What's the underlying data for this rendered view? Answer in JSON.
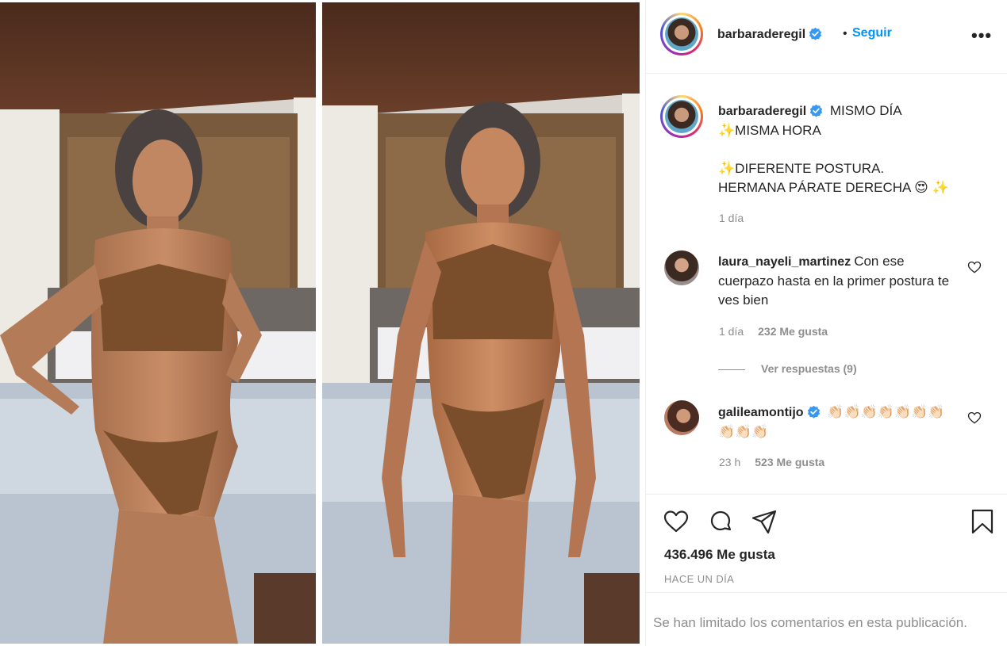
{
  "post": {
    "username": "barbaraderegil",
    "dot": "•",
    "follow_label": "Seguir",
    "more_label": "•••"
  },
  "caption": {
    "username": "barbaraderegil",
    "line1": "MISMO DÍA",
    "line2": "✨MISMA HORA",
    "line3": "✨DIFERENTE POSTURA.",
    "line4": "HERMANA PÁRATE DERECHA 😍 ✨",
    "time": "1 día"
  },
  "comments": [
    {
      "username": "laura_nayeli_martinez",
      "text": "Con ese cuerpazo hasta en la primer postura te ves bien",
      "time": "1 día",
      "likes": "232 Me gusta"
    },
    {
      "username": "galileamontijo",
      "text": "👏🏻👏🏻👏🏻👏🏻👏🏻👏🏻👏🏻👏🏻👏🏻👏🏻",
      "time": "23 h",
      "likes": "523 Me gusta"
    }
  ],
  "replies_label": "Ver respuestas (9)",
  "footer": {
    "likes": "436.496 Me gusta",
    "time": "HACE UN DÍA",
    "limited": "Se han limitado los comentarios en esta publicación."
  },
  "colors": {
    "accent": "#0095f6",
    "verified": "#3897f0",
    "muted": "#8e8e8e",
    "text": "#262626"
  },
  "icons": [
    "heart-icon",
    "comment-icon",
    "share-icon",
    "bookmark-icon",
    "verified-badge-icon",
    "more-options-icon"
  ]
}
